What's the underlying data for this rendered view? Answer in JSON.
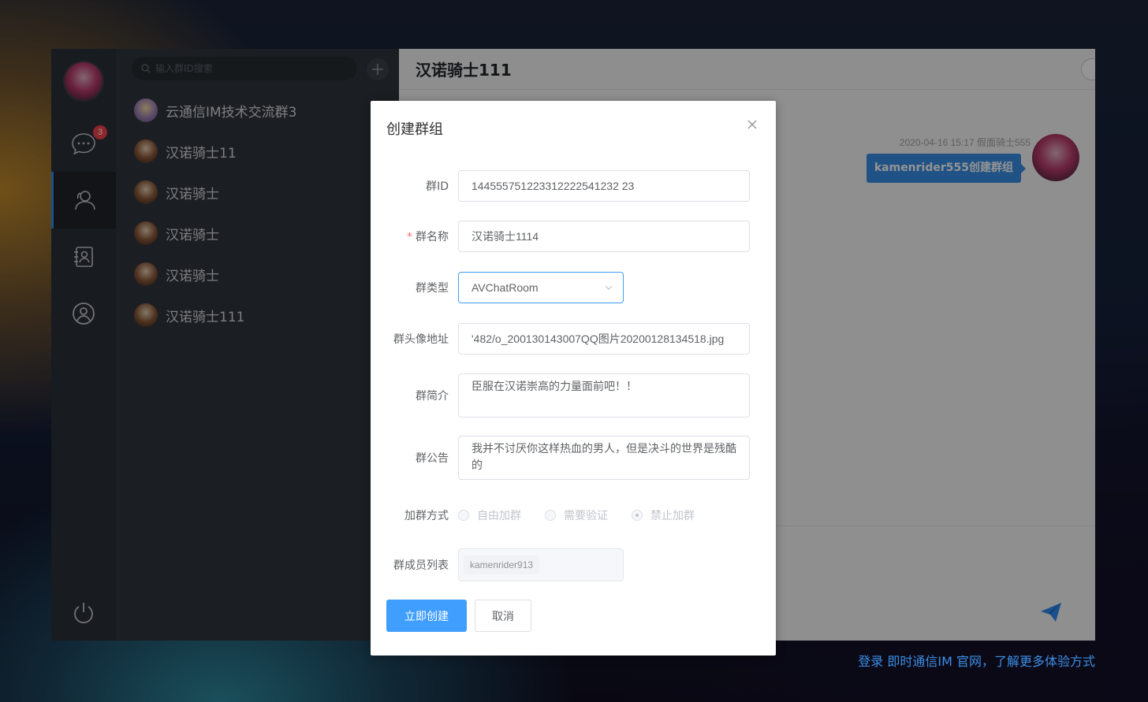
{
  "rail": {
    "unread_count": "3",
    "icons": [
      "chat-icon",
      "group-icon",
      "contacts-icon",
      "profile-icon",
      "power-icon"
    ]
  },
  "search": {
    "placeholder": "输入群ID搜索"
  },
  "conversations": [
    {
      "name": "云通信IM技术交流群3"
    },
    {
      "name": "汉诺骑士11"
    },
    {
      "name": "汉诺骑士"
    },
    {
      "name": "汉诺骑士"
    },
    {
      "name": "汉诺骑士"
    },
    {
      "name": "汉诺骑士111"
    }
  ],
  "chat": {
    "title": "汉诺骑士111",
    "message": {
      "meta": "2020-04-16 15:17 假面骑士555",
      "text": "kamenrider555创建群组"
    }
  },
  "dialog": {
    "title": "创建群组",
    "fields": {
      "group_id": {
        "label": "群ID",
        "value": "144555751223312222541232 23"
      },
      "group_name": {
        "label": "群名称",
        "required": "*",
        "value": "汉诺骑士1114"
      },
      "group_type": {
        "label": "群类型",
        "value": "AVChatRoom"
      },
      "avatar_url": {
        "label": "群头像地址",
        "value": "'482/o_200130143007QQ图片20200128134518.jpg"
      },
      "intro": {
        "label": "群简介",
        "value": "臣服在汉诺崇高的力量面前吧！！"
      },
      "notice": {
        "label": "群公告",
        "value": "我并不讨厌你这样热血的男人，但是决斗的世界是残酷的"
      },
      "join_option": {
        "label": "加群方式",
        "options": [
          "自由加群",
          "需要验证",
          "禁止加群"
        ],
        "selected": "禁止加群"
      },
      "members": {
        "label": "群成员列表",
        "tags": [
          "kamenrider913"
        ]
      }
    },
    "buttons": {
      "submit": "立即创建",
      "cancel": "取消"
    }
  },
  "footer": {
    "link": "登录 即时通信IM 官网，了解更多体验方式"
  },
  "colors": {
    "primary": "#409eff",
    "badge": "#f0434e",
    "bubble": "#3a8ee6",
    "link": "#3b8ee6"
  }
}
